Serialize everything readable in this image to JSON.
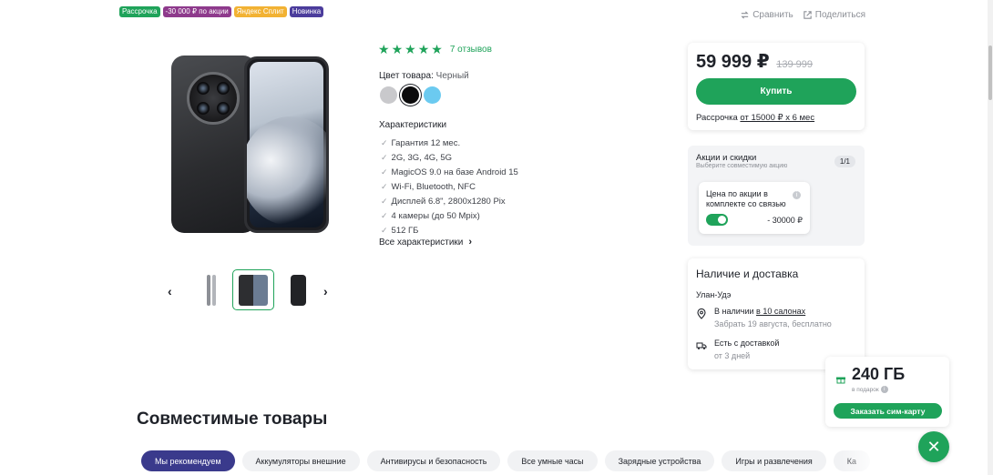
{
  "badges": [
    {
      "label": "Рассрочка",
      "color": "#1fa35a"
    },
    {
      "label": "-30 000 ₽ по акции",
      "color": "#8e3a8c"
    },
    {
      "label": "Яндекс Сплит",
      "color": "#f2b233"
    },
    {
      "label": "Новинка",
      "color": "#4b3c9c"
    }
  ],
  "top_actions": {
    "compare": "Сравнить",
    "share": "Поделиться"
  },
  "rating": {
    "stars": 5,
    "reviews": "7 отзывов"
  },
  "color": {
    "label": "Цвет товара:",
    "value": "Черный",
    "swatches": [
      "#c9c9cc",
      "#0b0b0c",
      "#6bcaf0"
    ],
    "selected": 1
  },
  "specs": {
    "title": "Характеристики",
    "items": [
      "Гарантия 12 мес.",
      "2G, 3G, 4G, 5G",
      "MagicOS 9.0 на базе Android 15",
      "Wi-Fi, Bluetooth, NFC",
      "Дисплей 6.8\", 2800x1280 Pix",
      "4 камеры (до 50 Mpix)",
      "512 ГБ"
    ],
    "all_link": "Все характеристики"
  },
  "price": {
    "current": "59 999 ₽",
    "old": "139 999",
    "buy": "Купить",
    "installment_prefix": "Рассрочка",
    "installment_link": "от 15000 ₽ х 6 мес"
  },
  "promo": {
    "title": "Акции и скидки",
    "subtitle": "Выберите совместимую акцию",
    "counter": "1/1",
    "offer_text": "Цена по акции в комплекте со связью",
    "offer_price": "- 30000 ₽",
    "enabled": true
  },
  "availability": {
    "title": "Наличие и доставка",
    "city": "Улан-Удэ",
    "pickup_prefix": "В наличии",
    "pickup_link": "в 10 салонах",
    "pickup_sub": "Забрать 19 августа, бесплатно",
    "delivery": "Есть с доставкой",
    "delivery_sub": "от 3 дней"
  },
  "gift": {
    "amount": "240 ГБ",
    "label": "в подарок",
    "button": "Заказать сим-карту"
  },
  "compatible": {
    "title": "Совместимые товары",
    "categories": [
      "Мы рекомендуем",
      "Аккумуляторы внешние",
      "Антивирусы и безопасность",
      "Все умные часы",
      "Зарядные устройства",
      "Игры и развлечения",
      "Ка"
    ],
    "active": 0
  },
  "nav": {
    "prev": "‹",
    "next": "›"
  }
}
